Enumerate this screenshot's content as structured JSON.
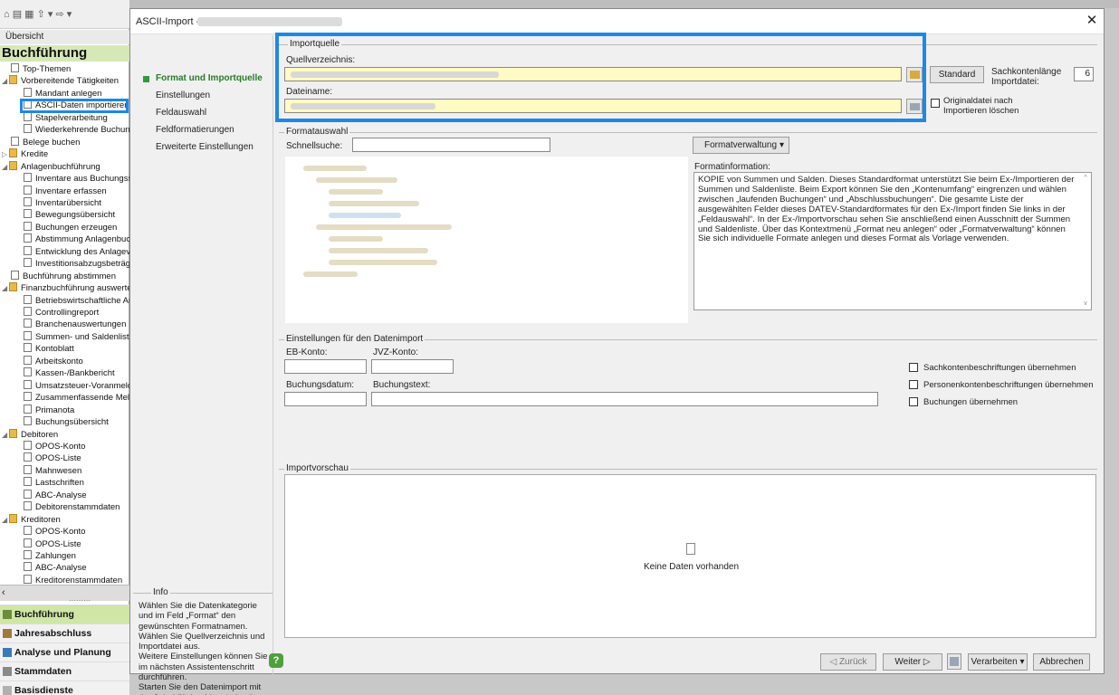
{
  "bg_app": {
    "quick_access": "⌂ ▤ ▦ ⇧ ▾ ⇨ ▾",
    "overview_tab": "Übersicht",
    "nav_title": "Buchführung",
    "tree": [
      {
        "label": "Top-Themen",
        "indent": 1,
        "icon": "doc",
        "twist": ""
      },
      {
        "label": "Vorbereitende Tätigkeiten",
        "indent": 0,
        "icon": "fold",
        "twist": "◢"
      },
      {
        "label": "Mandant anlegen",
        "indent": 2,
        "icon": "doc",
        "twist": ""
      },
      {
        "label": "ASCII-Daten importieren",
        "indent": 2,
        "icon": "doc",
        "twist": ""
      },
      {
        "label": "Stapelverarbeitung",
        "indent": 2,
        "icon": "doc",
        "twist": ""
      },
      {
        "label": "Wiederkehrende Buchungen",
        "indent": 2,
        "icon": "doc",
        "twist": ""
      },
      {
        "label": "Belege buchen",
        "indent": 1,
        "icon": "doc",
        "twist": ""
      },
      {
        "label": "Kredite",
        "indent": 0,
        "icon": "fold",
        "twist": "▷"
      },
      {
        "label": "Anlagenbuchführung",
        "indent": 0,
        "icon": "fold",
        "twist": "◢"
      },
      {
        "label": "Inventare aus Buchungssätzen",
        "indent": 2,
        "icon": "doc",
        "twist": ""
      },
      {
        "label": "Inventare erfassen",
        "indent": 2,
        "icon": "doc",
        "twist": ""
      },
      {
        "label": "Inventarübersicht",
        "indent": 2,
        "icon": "doc",
        "twist": ""
      },
      {
        "label": "Bewegungsübersicht",
        "indent": 2,
        "icon": "doc",
        "twist": ""
      },
      {
        "label": "Buchungen erzeugen",
        "indent": 2,
        "icon": "doc",
        "twist": ""
      },
      {
        "label": "Abstimmung Anlagenbuchführung",
        "indent": 2,
        "icon": "doc",
        "twist": ""
      },
      {
        "label": "Entwicklung des Anlagevermögens",
        "indent": 2,
        "icon": "doc",
        "twist": ""
      },
      {
        "label": "Investitionsabzugsbeträge",
        "indent": 2,
        "icon": "doc",
        "twist": ""
      },
      {
        "label": "Buchführung abstimmen",
        "indent": 1,
        "icon": "doc",
        "twist": ""
      },
      {
        "label": "Finanzbuchführung auswerten",
        "indent": 0,
        "icon": "fold",
        "twist": "◢"
      },
      {
        "label": "Betriebswirtschaftliche Auswertungen",
        "indent": 2,
        "icon": "doc",
        "twist": ""
      },
      {
        "label": "Controllingreport",
        "indent": 2,
        "icon": "doc",
        "twist": ""
      },
      {
        "label": "Branchenauswertungen",
        "indent": 2,
        "icon": "doc",
        "twist": ""
      },
      {
        "label": "Summen- und Saldenliste",
        "indent": 2,
        "icon": "doc",
        "twist": ""
      },
      {
        "label": "Kontoblatt",
        "indent": 2,
        "icon": "doc",
        "twist": ""
      },
      {
        "label": "Arbeitskonto",
        "indent": 2,
        "icon": "doc",
        "twist": ""
      },
      {
        "label": "Kassen-/Bankbericht",
        "indent": 2,
        "icon": "doc",
        "twist": ""
      },
      {
        "label": "Umsatzsteuer-Voranmeldung",
        "indent": 2,
        "icon": "doc",
        "twist": ""
      },
      {
        "label": "Zusammenfassende Meldung",
        "indent": 2,
        "icon": "doc",
        "twist": ""
      },
      {
        "label": "Primanota",
        "indent": 2,
        "icon": "doc",
        "twist": ""
      },
      {
        "label": "Buchungsübersicht",
        "indent": 2,
        "icon": "doc",
        "twist": ""
      },
      {
        "label": "Debitoren",
        "indent": 0,
        "icon": "fold",
        "twist": "◢"
      },
      {
        "label": "OPOS-Konto",
        "indent": 2,
        "icon": "doc",
        "twist": ""
      },
      {
        "label": "OPOS-Liste",
        "indent": 2,
        "icon": "doc",
        "twist": ""
      },
      {
        "label": "Mahnwesen",
        "indent": 2,
        "icon": "doc",
        "twist": ""
      },
      {
        "label": "Lastschriften",
        "indent": 2,
        "icon": "doc",
        "twist": ""
      },
      {
        "label": "ABC-Analyse",
        "indent": 2,
        "icon": "doc",
        "twist": ""
      },
      {
        "label": "Debitorenstammdaten",
        "indent": 2,
        "icon": "doc",
        "twist": ""
      },
      {
        "label": "Kreditoren",
        "indent": 0,
        "icon": "fold",
        "twist": "◢"
      },
      {
        "label": "OPOS-Konto",
        "indent": 2,
        "icon": "doc",
        "twist": ""
      },
      {
        "label": "OPOS-Liste",
        "indent": 2,
        "icon": "doc",
        "twist": ""
      },
      {
        "label": "Zahlungen",
        "indent": 2,
        "icon": "doc",
        "twist": ""
      },
      {
        "label": "ABC-Analyse",
        "indent": 2,
        "icon": "doc",
        "twist": ""
      },
      {
        "label": "Kreditorenstammdaten",
        "indent": 2,
        "icon": "doc",
        "twist": ""
      }
    ],
    "scroll_left": "‹",
    "scroll_dots": "·········",
    "nav_buttons": [
      "Buchführung",
      "Jahresabschluss",
      "Analyse und Planung",
      "Stammdaten",
      "Basisdienste"
    ]
  },
  "dialog": {
    "title": "ASCII-Import -",
    "close_glyph": "✕",
    "steps": [
      "Format und Importquelle",
      "Einstellungen",
      "Feldauswahl",
      "Feldformatierungen",
      "Erweiterte Einstellungen"
    ],
    "info_label": "Info",
    "info_text": "Wählen Sie die Datenkategorie\nund im Feld „Format“ den\ngewünschten Formatnamen.\nWählen Sie Quellverzeichnis und\nImportdatei aus.\nWeitere Einstellungen können Sie\nim nächsten Assistentenschritt\ndurchführen.\nStarten Sie den Datenimport mit\nder Schaltfläche „Verarbeiten“.",
    "import_source": {
      "legend": "Importquelle",
      "source_dir_label": "Quellverzeichnis:",
      "filename_label": "Dateiname:",
      "standard_button": "Standard",
      "account_length_label": "Sachkontenlänge\nImportdatei:",
      "account_length_value": "6",
      "delete_original_label": "Originaldatei nach\nImportieren löschen"
    },
    "format_selection": {
      "legend": "Formatauswahl",
      "quicksearch_label": "Schnellsuche:",
      "format_mgmt_button": "Formatverwaltung",
      "format_info_label": "Formatinformation:",
      "format_info_text": "KOPIE von Summen und Salden. Dieses Standardformat unterstützt Sie beim Ex-/Importieren der Summen und Saldenliste. Beim Export können Sie den „Kontenumfang“ eingrenzen und wählen zwischen „laufenden Buchungen“ und „Abschlussbuchungen“. Die gesamte Liste der ausgewählten Felder dieses DATEV-Standardformates für den Ex-/Import finden Sie links in der „Feldauswahl“. In der Ex-/Importvorschau sehen Sie anschließend einen Ausschnitt der Summen und Saldenliste. Über das Kontextmenü „Format neu anlegen“ oder „Formatverwaltung“ können Sie sich individuelle Formate anlegen und dieses Format als Vorlage verwenden."
    },
    "import_settings": {
      "legend": "Einstellungen für den Datenimport",
      "eb_label": "EB-Konto:",
      "jvz_label": "JVZ-Konto:",
      "date_label": "Buchungsdatum:",
      "text_label": "Buchungstext:",
      "cb1": "Sachkontenbeschriftungen übernehmen",
      "cb2": "Personenkontenbeschriftungen übernehmen",
      "cb3": "Buchungen übernehmen"
    },
    "preview": {
      "legend": "Importvorschau",
      "empty_text": "Keine Daten vorhanden"
    },
    "buttons": {
      "help": "?",
      "back": "◁ Zurück",
      "next": "Weiter ▷",
      "process": "Verarbeiten ▾",
      "cancel": "Abbrechen"
    }
  },
  "colors": {
    "highlight": "#1e88e5",
    "input_yellow": "#fffbc2",
    "nav_green": "#cfe6a6"
  }
}
